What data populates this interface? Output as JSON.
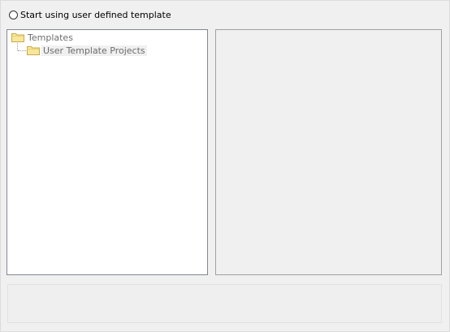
{
  "template_option": {
    "label": "Start using user defined template",
    "selected": false
  },
  "tree": {
    "root": {
      "label": "Templates",
      "icon": "folder-icon"
    },
    "children": [
      {
        "label": "User Template Projects",
        "icon": "folder-icon"
      }
    ]
  },
  "colors": {
    "folder_fill": "#f8e79b",
    "folder_stroke": "#c7a94a"
  }
}
